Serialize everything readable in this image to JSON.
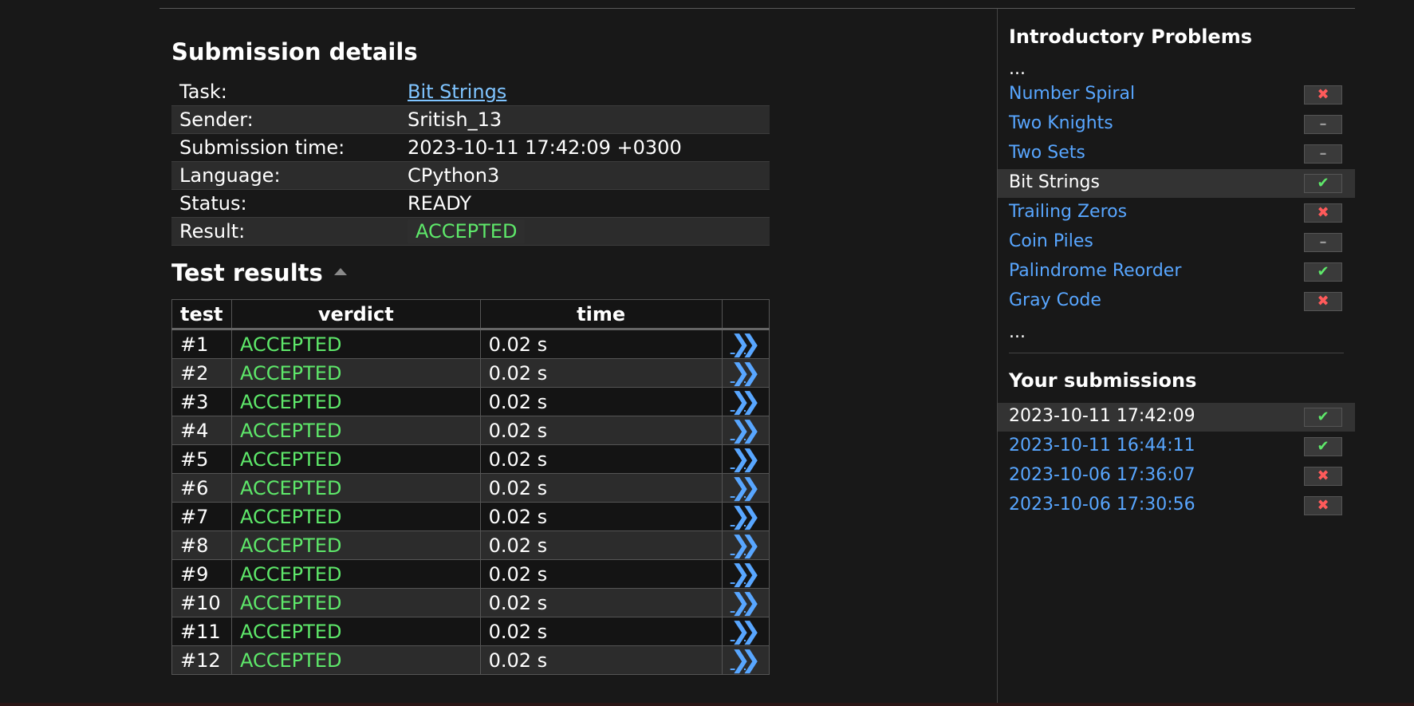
{
  "details": {
    "title": "Submission details",
    "rows": [
      {
        "key": "Task:",
        "value": "Bit Strings"
      },
      {
        "key": "Sender:",
        "value": "Sritish_13"
      },
      {
        "key": "Submission time:",
        "value": "2023-10-11 17:42:09 +0300"
      },
      {
        "key": "Language:",
        "value": "CPython3"
      },
      {
        "key": "Status:",
        "value": "READY"
      },
      {
        "key": "Result:",
        "value": "ACCEPTED"
      }
    ]
  },
  "tests": {
    "title": "Test results",
    "headers": [
      "test",
      "verdict",
      "time"
    ],
    "rows": [
      {
        "test": "#1",
        "verdict": "ACCEPTED",
        "time": "0.02 s"
      },
      {
        "test": "#2",
        "verdict": "ACCEPTED",
        "time": "0.02 s"
      },
      {
        "test": "#3",
        "verdict": "ACCEPTED",
        "time": "0.02 s"
      },
      {
        "test": "#4",
        "verdict": "ACCEPTED",
        "time": "0.02 s"
      },
      {
        "test": "#5",
        "verdict": "ACCEPTED",
        "time": "0.02 s"
      },
      {
        "test": "#6",
        "verdict": "ACCEPTED",
        "time": "0.02 s"
      },
      {
        "test": "#7",
        "verdict": "ACCEPTED",
        "time": "0.02 s"
      },
      {
        "test": "#8",
        "verdict": "ACCEPTED",
        "time": "0.02 s"
      },
      {
        "test": "#9",
        "verdict": "ACCEPTED",
        "time": "0.02 s"
      },
      {
        "test": "#10",
        "verdict": "ACCEPTED",
        "time": "0.02 s"
      },
      {
        "test": "#11",
        "verdict": "ACCEPTED",
        "time": "0.02 s"
      },
      {
        "test": "#12",
        "verdict": "ACCEPTED",
        "time": "0.02 s"
      }
    ]
  },
  "sidebar": {
    "problems_title": "Introductory Problems",
    "ellipsis": "...",
    "problems": [
      {
        "name": "Number Spiral",
        "status": "fail",
        "current": false
      },
      {
        "name": "Two Knights",
        "status": "none",
        "current": false
      },
      {
        "name": "Two Sets",
        "status": "none",
        "current": false
      },
      {
        "name": "Bit Strings",
        "status": "pass",
        "current": true
      },
      {
        "name": "Trailing Zeros",
        "status": "fail",
        "current": false
      },
      {
        "name": "Coin Piles",
        "status": "none",
        "current": false
      },
      {
        "name": "Palindrome Reorder",
        "status": "pass",
        "current": false
      },
      {
        "name": "Gray Code",
        "status": "fail",
        "current": false
      }
    ],
    "submissions_title": "Your submissions",
    "submissions": [
      {
        "time": "2023-10-11 17:42:09",
        "status": "pass",
        "current": true
      },
      {
        "time": "2023-10-11 16:44:11",
        "status": "pass",
        "current": false
      },
      {
        "time": "2023-10-06 17:36:07",
        "status": "fail",
        "current": false
      },
      {
        "time": "2023-10-06 17:30:56",
        "status": "fail",
        "current": false
      }
    ]
  },
  "icons": {
    "pass": "check-icon",
    "fail": "cross-icon",
    "none": "dash-icon",
    "view": "double-chevron-right-icon",
    "sort": "sort-up-icon"
  },
  "colors": {
    "background": "#181818",
    "accepted": "#5ee86a",
    "link": "#58a6ff",
    "fail": "#ff5a5a"
  }
}
